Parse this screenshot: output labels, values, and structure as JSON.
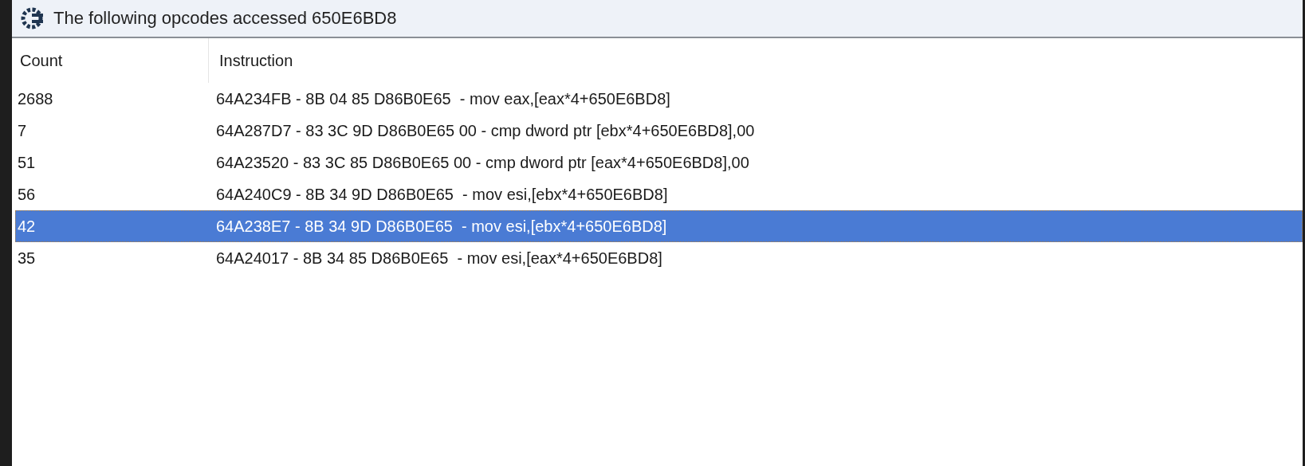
{
  "window": {
    "title": "The following opcodes accessed 650E6BD8"
  },
  "table": {
    "columns": [
      "Count",
      "Instruction"
    ],
    "rows": [
      {
        "count": "2688",
        "instruction": "64A234FB - 8B 04 85 D86B0E65  - mov eax,[eax*4+650E6BD8]",
        "selected": false
      },
      {
        "count": "7",
        "instruction": "64A287D7 - 83 3C 9D D86B0E65 00 - cmp dword ptr [ebx*4+650E6BD8],00",
        "selected": false
      },
      {
        "count": "51",
        "instruction": "64A23520 - 83 3C 85 D86B0E65 00 - cmp dword ptr [eax*4+650E6BD8],00",
        "selected": false
      },
      {
        "count": "56",
        "instruction": "64A240C9 - 8B 34 9D D86B0E65  - mov esi,[ebx*4+650E6BD8]",
        "selected": false
      },
      {
        "count": "42",
        "instruction": "64A238E7 - 8B 34 9D D86B0E65  - mov esi,[ebx*4+650E6BD8]",
        "selected": true
      },
      {
        "count": "35",
        "instruction": "64A24017 - 8B 34 85 D86B0E65  - mov esi,[eax*4+650E6BD8]",
        "selected": false
      }
    ]
  }
}
